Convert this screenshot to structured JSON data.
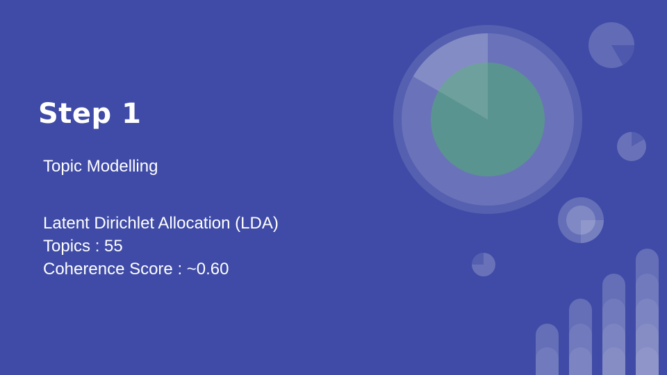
{
  "slide": {
    "title": "Step 1",
    "subtitle": "Topic Modelling",
    "details": [
      "Latent Dirichlet Allocation (LDA)",
      "Topics : 55",
      "Coherence Score : ~0.60"
    ]
  },
  "colors": {
    "background": "#3f4ba6",
    "accent_green": "#5a9490",
    "text": "#ffffff"
  },
  "icons": {
    "decoration": [
      "donut-chart-icon",
      "pie-chart-icon",
      "bar-chart-icon"
    ]
  }
}
